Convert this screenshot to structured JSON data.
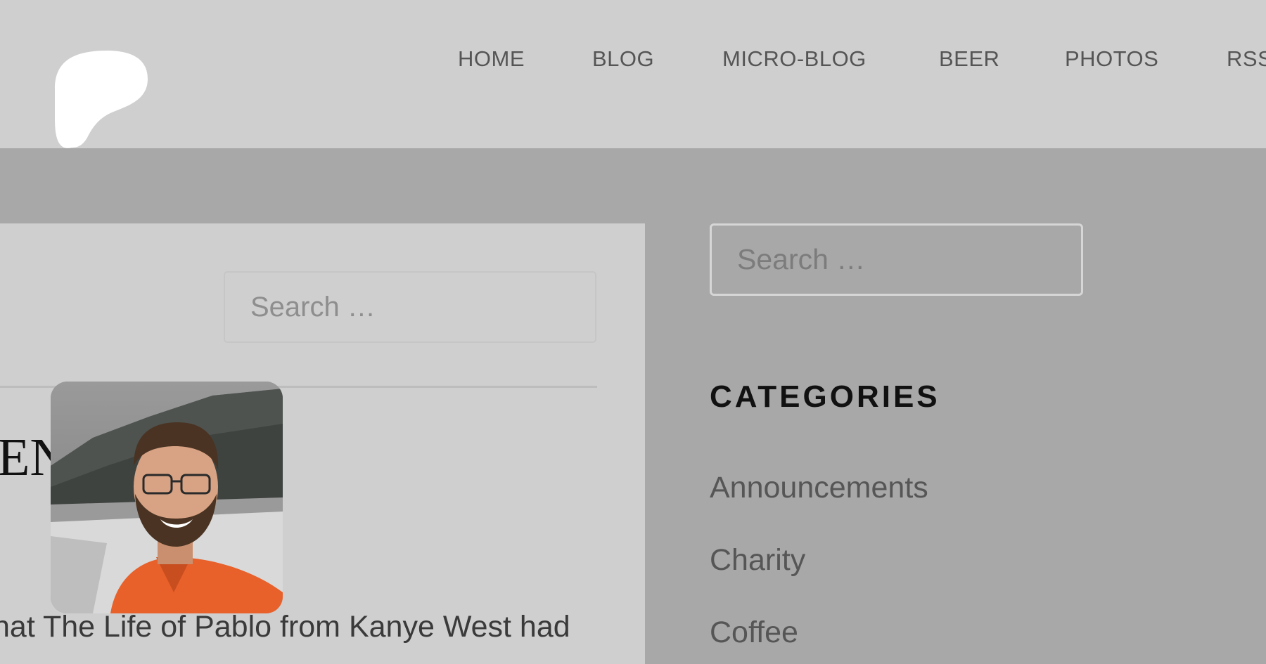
{
  "nav": {
    "items": [
      {
        "label": "HOME"
      },
      {
        "label": "BLOG"
      },
      {
        "label": "MICRO-BLOG"
      },
      {
        "label": "BEER"
      },
      {
        "label": "PHOTOS"
      },
      {
        "label": "RSS"
      }
    ]
  },
  "main": {
    "search": {
      "placeholder": "Search …"
    },
    "post": {
      "title": "EN      ED?",
      "excerpt": "hat The Life of Pablo from Kanye West had"
    }
  },
  "sidebar": {
    "search": {
      "placeholder": "Search …"
    },
    "categories_title": "CATEGORIES",
    "categories": [
      {
        "label": "Announcements"
      },
      {
        "label": "Charity"
      },
      {
        "label": "Coffee"
      }
    ]
  },
  "colors": {
    "header_bg": "#cfcfcf",
    "page_bg": "#a8a8a8",
    "avatar_shirt": "#e8602a"
  }
}
